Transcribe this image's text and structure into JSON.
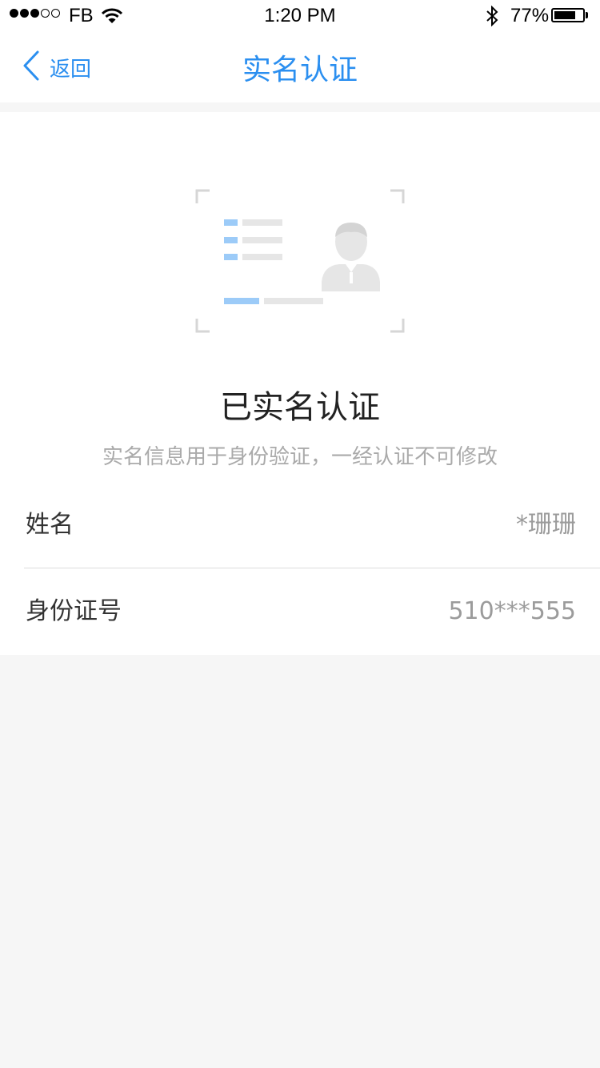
{
  "status_bar": {
    "carrier": "FB",
    "time": "1:20 PM",
    "battery_percent": "77%",
    "battery_level": 0.77,
    "signal_bars_filled": 3,
    "signal_bars_total": 5
  },
  "nav": {
    "back_label": "返回",
    "title": "实名认证"
  },
  "verified": {
    "heading": "已实名认证",
    "subtext": "实名信息用于身份验证，一经认证不可修改"
  },
  "fields": [
    {
      "label": "姓名",
      "value": "*珊珊"
    },
    {
      "label": "身份证号",
      "value": "510***555"
    }
  ],
  "colors": {
    "accent": "#2b8ff0",
    "illustration_blue": "#9ccbf8",
    "illustration_gray": "#e6e6e6",
    "background": "#f6f6f6"
  },
  "icons": {
    "back": "chevron-left-icon",
    "wifi": "wifi-icon",
    "bluetooth": "bluetooth-icon",
    "battery": "battery-icon",
    "illustration": "id-card-icon"
  }
}
